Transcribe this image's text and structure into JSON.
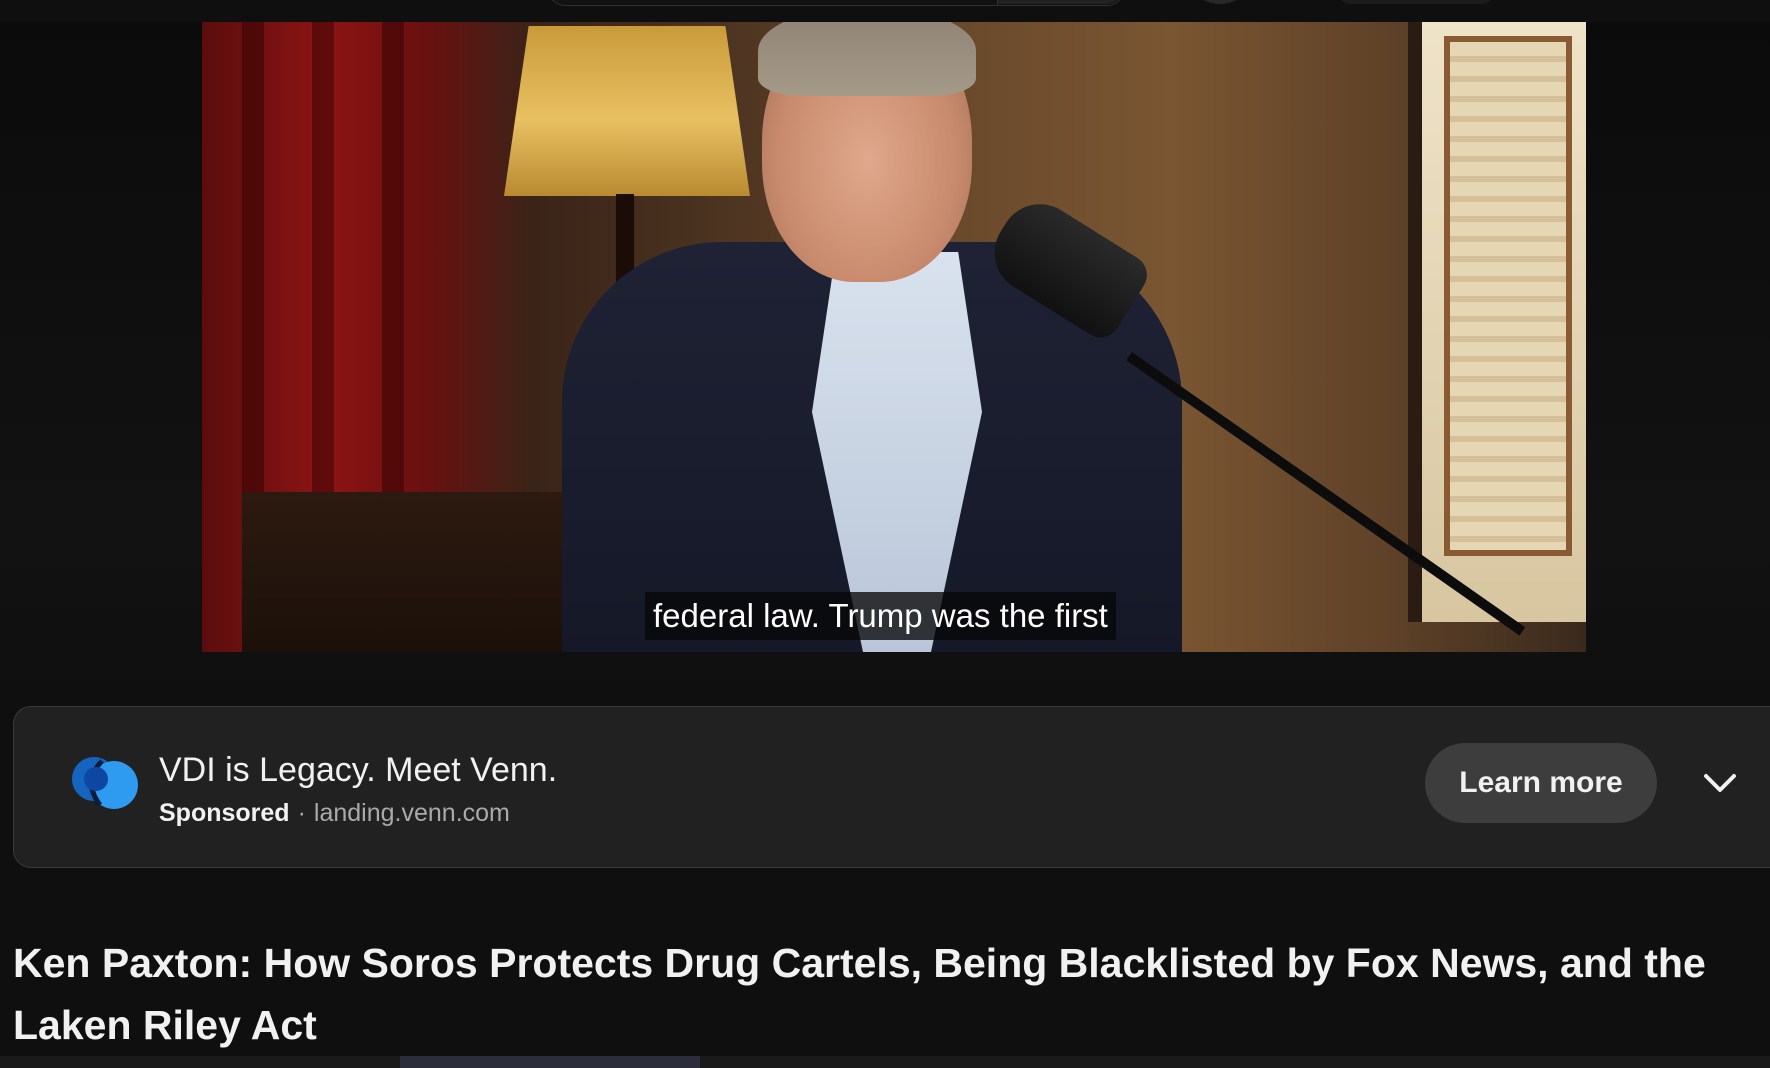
{
  "player": {
    "caption": "federal law. Trump was the first"
  },
  "ad": {
    "headline": "VDI is Legacy. Meet Venn.",
    "sponsored_label": "Sponsored",
    "separator": "·",
    "domain": "landing.venn.com",
    "cta_label": "Learn more",
    "logo_icon": "venn-logo-icon",
    "expand_icon": "chevron-down-icon",
    "colors": {
      "card_bg": "#212121",
      "cta_bg": "#3d3d3d",
      "logo_primary": "#1565c0",
      "logo_secondary": "#2e9bf0"
    }
  },
  "video": {
    "title": "Ken Paxton: How Soros Protects Drug Cartels, Being Blacklisted by Fox News, and the Laken Riley Act"
  }
}
